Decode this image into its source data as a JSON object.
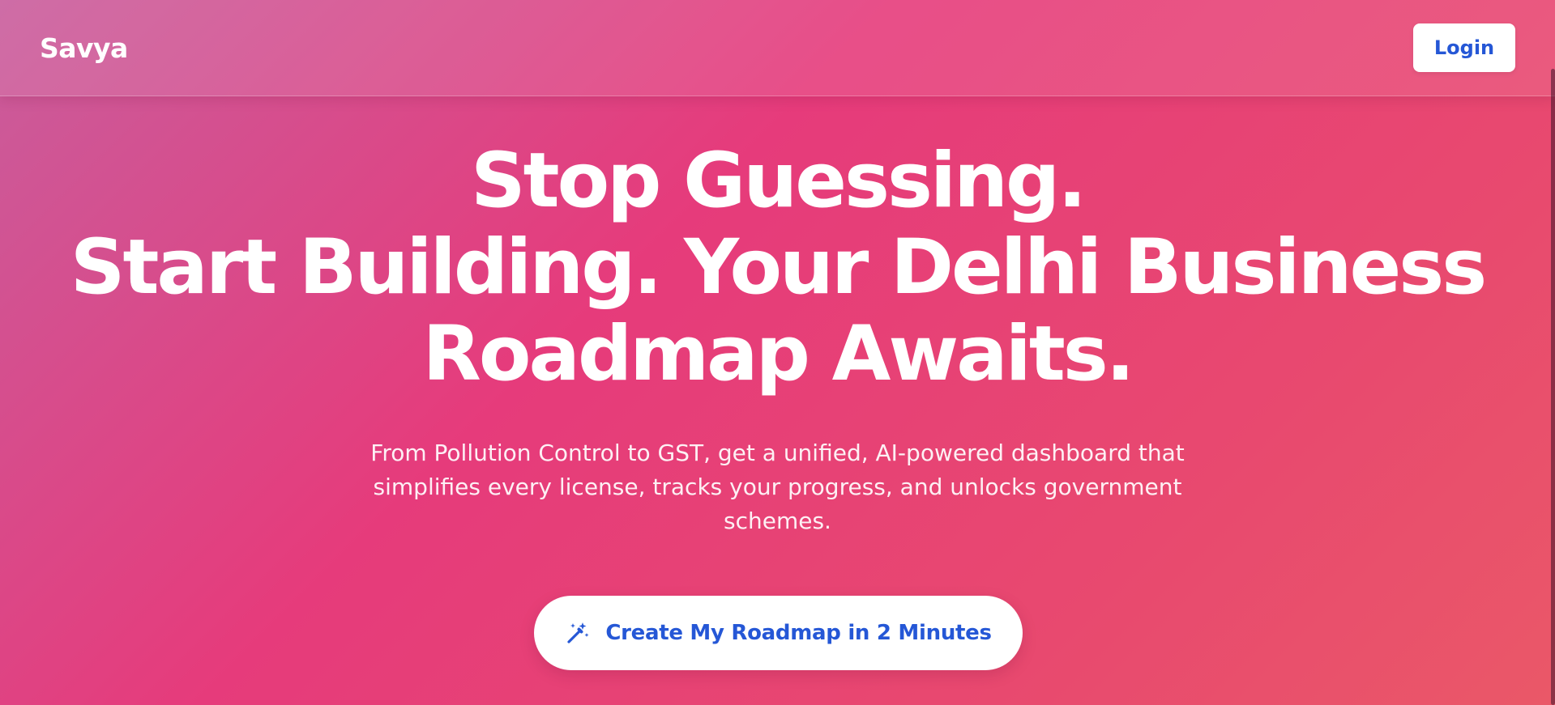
{
  "nav": {
    "brand": "Savya",
    "login_label": "Login"
  },
  "hero": {
    "headline_line1": "Stop Guessing.",
    "headline_line2": "Start Building. Your Delhi Business",
    "headline_line3": "Roadmap Awaits.",
    "subtitle": "From Pollution Control to GST, get a unified, AI-powered dashboard that simplifies every license, tracks your progress, and unlocks government schemes.",
    "cta_label": "Create My Roadmap in 2 Minutes",
    "cta_icon": "magic-wand-icon"
  },
  "colors": {
    "accent": "#2557d6",
    "background_start": "#c95d9c",
    "background_mid": "#e63b7b",
    "background_end": "#ea5868"
  }
}
